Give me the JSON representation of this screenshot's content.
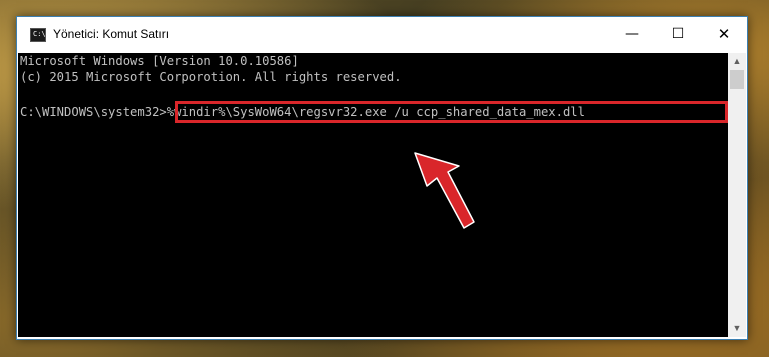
{
  "window": {
    "title": "Yönetici: Komut Satırı"
  },
  "controls": {
    "minimize": "—",
    "maximize": "☐",
    "close": "✕"
  },
  "console": {
    "line1": "Microsoft Windows [Version 10.0.10586]",
    "line2": "(c) 2015 Microsoft Corporotion. All rights reserved.",
    "prompt": "C:\\WINDOWS\\system32>",
    "command": "%windir%\\SysWoW64\\regsvr32.exe /u ccp_shared_data_mex.dll"
  },
  "icons": {
    "app": "cmd-icon",
    "arrow": "red-arrow-icon",
    "scroll_up": "scroll-up-icon",
    "scroll_down": "scroll-down-icon"
  },
  "colors": {
    "highlight": "#d9262a",
    "console_bg": "#000000",
    "console_text": "#c0c0c0"
  }
}
